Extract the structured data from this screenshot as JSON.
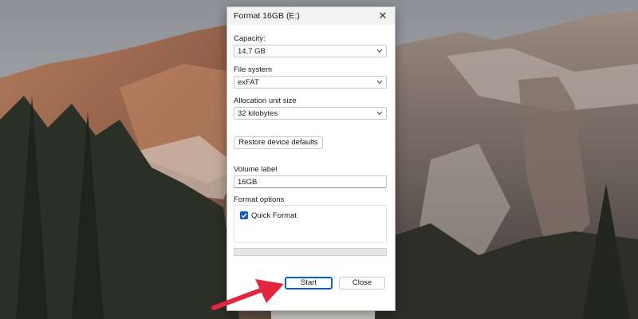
{
  "dialog": {
    "title": "Format 16GB (E:)",
    "capacity": {
      "label": "Capacity:",
      "value": "14,7 GB"
    },
    "file_system": {
      "label": "File system",
      "value": "exFAT"
    },
    "allocation": {
      "label": "Allocation unit size",
      "value": "32 kilobytes"
    },
    "restore_label": "Restore device defaults",
    "volume": {
      "label": "Volume label",
      "value": "16GB"
    },
    "format_options": {
      "title": "Format options",
      "quick_format_label": "Quick Format",
      "quick_format_checked": true
    },
    "progress": 0,
    "start_label": "Start",
    "close_label": "Close"
  },
  "colors": {
    "accent": "#0a5fc7",
    "arrow": "#e3263f"
  }
}
